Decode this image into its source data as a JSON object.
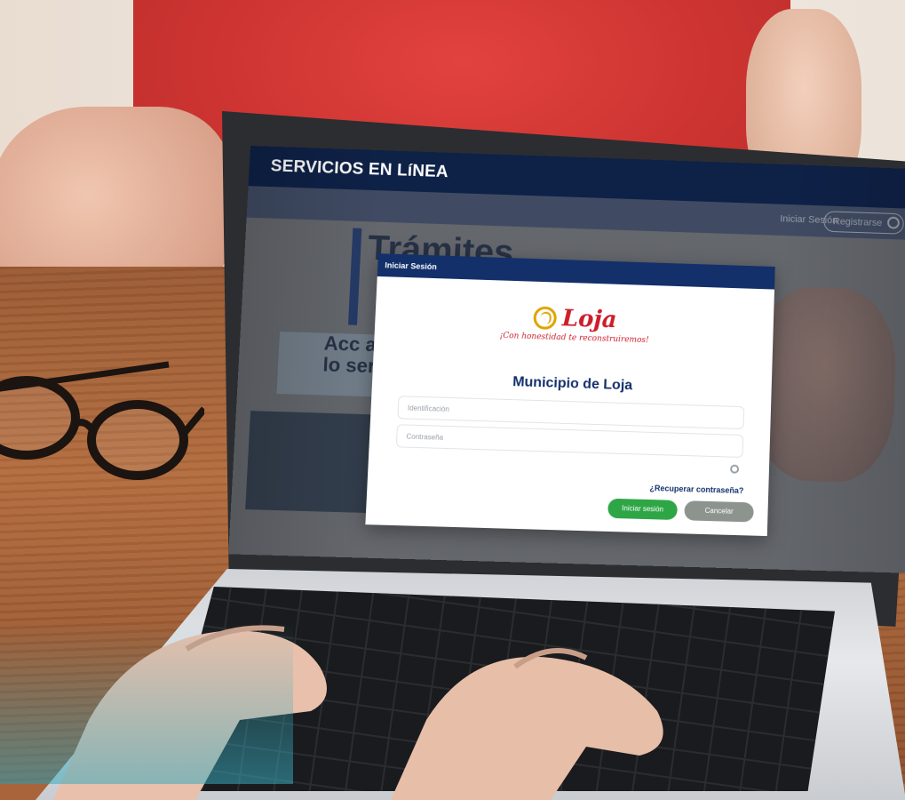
{
  "site": {
    "title": "SERVICIOS EN LíNEA",
    "nav_login": "Iniciar Sesión",
    "nav_register": "Registrarse"
  },
  "background_page": {
    "heading": "Trámites",
    "card_text": "Acc a lo ser"
  },
  "modal": {
    "header": "Iniciar Sesión",
    "logo_word": "Loja",
    "logo_slogan": "¡Con honestidad te reconstruiremos!",
    "title": "Municipio de Loja",
    "id_placeholder": "Identificación",
    "password_placeholder": "Contraseña",
    "recover_link": "¿Recuperar contraseña?",
    "login_button": "Iniciar sesión",
    "cancel_button": "Cancelar"
  },
  "colors": {
    "navy": "#0e2147",
    "modal_header": "#13306b",
    "login_green": "#2ea646",
    "cancel_gray": "#8d9490",
    "logo_red": "#cc1e2a",
    "logo_gold": "#e0a300"
  },
  "icons": {
    "user": "user-icon",
    "eye": "eye-icon",
    "logo": "loja-logo-icon"
  }
}
